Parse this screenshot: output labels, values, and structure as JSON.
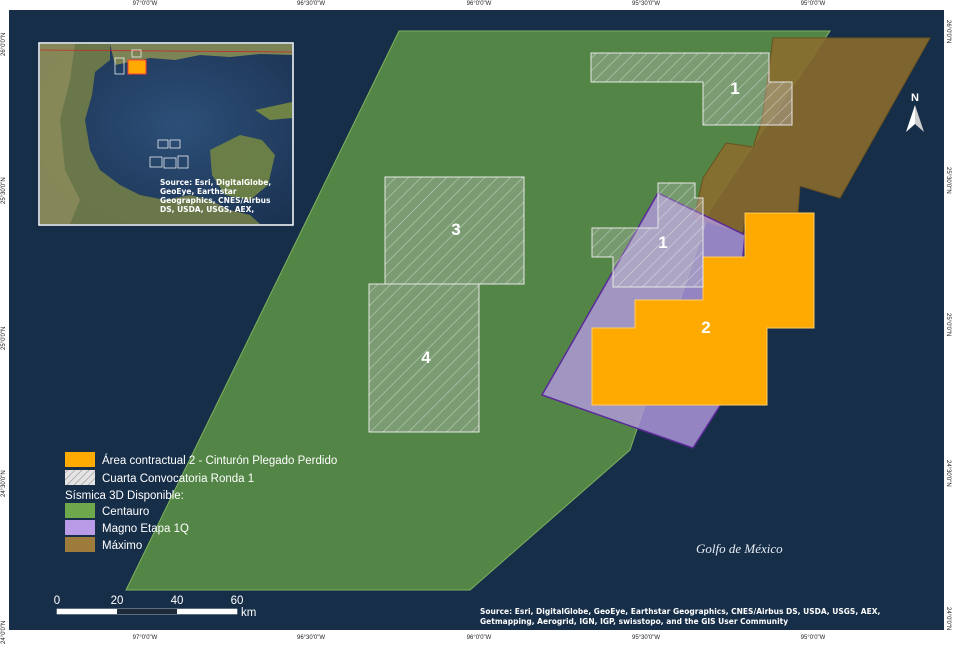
{
  "coords": {
    "top": [
      "97°0'0\"W",
      "96°30'0\"W",
      "96°0'0\"W",
      "95°30'0\"W",
      "95°0'0\"W"
    ],
    "bottom": [
      "97°0'0\"W",
      "96°30'0\"W",
      "96°0'0\"W",
      "95°30'0\"W",
      "95°0'0\"W"
    ],
    "left": [
      "26°0'0\"N",
      "25°30'0\"N",
      "25°0'0\"N",
      "24°30'0\"N",
      "24°0'0\"N"
    ],
    "right": [
      "26°0'0\"N",
      "25°30'0\"N",
      "25°0'0\"N",
      "24°30'0\"N",
      "24°0'0\"N"
    ]
  },
  "labels": {
    "block_1_top": "1",
    "block_1_mid": "1",
    "block_2": "2",
    "block_3": "3",
    "block_4": "4",
    "gulf": "Golfo de México",
    "north": "N"
  },
  "legend": {
    "items": [
      {
        "label": "Área contractual 2 - Cinturón Plegado Perdido",
        "color": "#ffa500",
        "pattern": "solid"
      },
      {
        "label": "Cuarta Convocatoria Ronda 1",
        "color": "#d8d8d8",
        "pattern": "hatch"
      }
    ],
    "heading": "Sísmica 3D Disponible:",
    "seismic": [
      {
        "label": "Centauro",
        "color": "#6fa84c"
      },
      {
        "label": "Magno Etapa 1Q",
        "color": "#b99be8"
      },
      {
        "label": "Máximo",
        "color": "#9d7b3a"
      }
    ]
  },
  "scalebar": {
    "ticks": [
      "0",
      "20",
      "40",
      "60"
    ],
    "unit": "km"
  },
  "inset": {
    "credit_lines": [
      "Source: Esri, DigitalGlobe,",
      "GeoEye, Earthstar",
      "Geographics, CNES/Airbus",
      "DS, USDA, USGS, AEX,"
    ]
  },
  "credits": {
    "line1": "Source: Esri, DigitalGlobe, GeoEye, Earthstar Geographics, CNES/Airbus DS, USDA, USGS, AEX,",
    "line2": "Getmapping, Aerogrid, IGN, IGP, swisstopo, and the GIS User Community"
  },
  "colors": {
    "ocean": "#1c3552",
    "centauro": "#5f9846",
    "magno": "#b49ae0",
    "maximo": "#8a6b2e",
    "area2": "#ffaa00",
    "hatch_block": "#c9c9c9"
  }
}
